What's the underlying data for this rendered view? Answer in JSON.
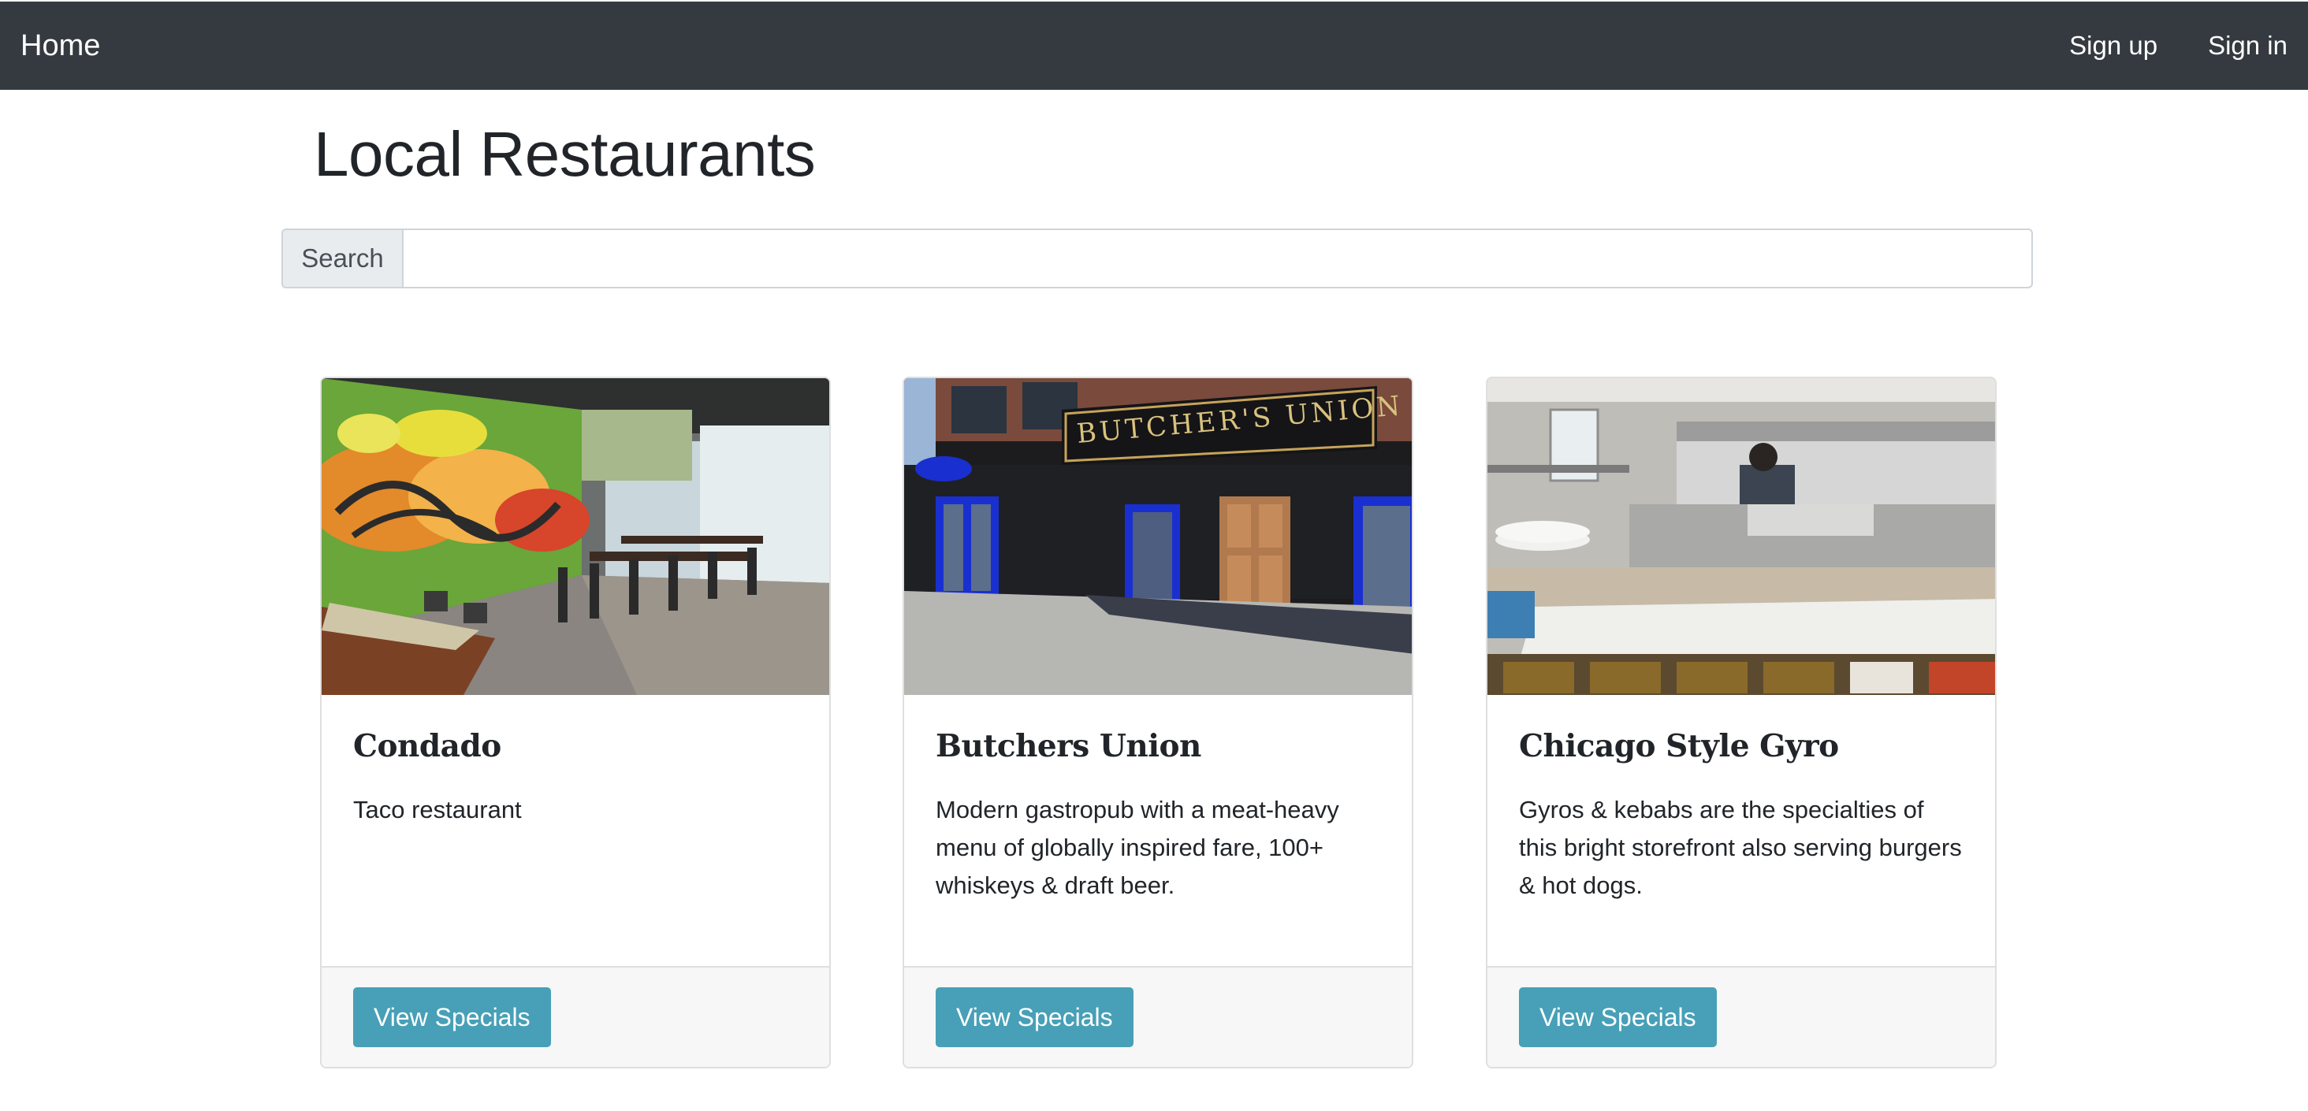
{
  "navbar": {
    "brand": "Home",
    "links": [
      "Sign up",
      "Sign in"
    ],
    "background": "#343a40"
  },
  "page": {
    "title": "Local Restaurants"
  },
  "search": {
    "label": "Search",
    "value": "",
    "placeholder": ""
  },
  "restaurants": [
    {
      "name": "Condado",
      "description": "Taco restaurant",
      "button_label": "View Specials",
      "image_alt": "graffiti-walled-dining-room"
    },
    {
      "name": "Butchers Union",
      "description": "Modern gastropub with a meat-heavy menu of globally inspired fare, 100+ whiskeys & draft beer.",
      "button_label": "View Specials",
      "image_alt": "black-storefront-with-blue-doors"
    },
    {
      "name": "Chicago Style Gyro",
      "description": "Gyros & kebabs are the specialties of this bright storefront also serving burgers & hot dogs.",
      "button_label": "View Specials",
      "image_alt": "restaurant-kitchen-counter"
    }
  ],
  "colors": {
    "button": "#47a0b7",
    "card_footer": "#f7f7f7"
  }
}
